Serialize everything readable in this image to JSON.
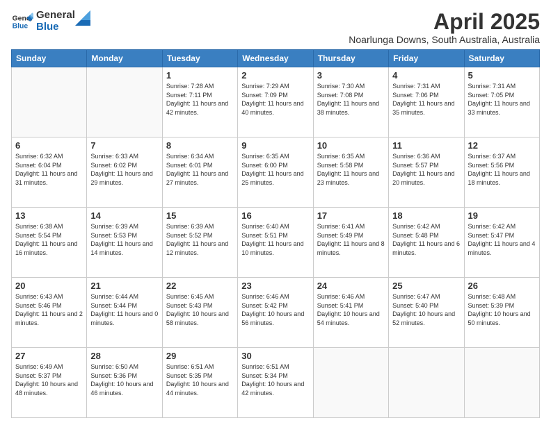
{
  "logo": {
    "text_general": "General",
    "text_blue": "Blue"
  },
  "header": {
    "title": "April 2025",
    "subtitle": "Noarlunga Downs, South Australia, Australia"
  },
  "days_of_week": [
    "Sunday",
    "Monday",
    "Tuesday",
    "Wednesday",
    "Thursday",
    "Friday",
    "Saturday"
  ],
  "weeks": [
    [
      {
        "day": "",
        "sunrise": "",
        "sunset": "",
        "daylight": "",
        "empty": true
      },
      {
        "day": "",
        "sunrise": "",
        "sunset": "",
        "daylight": "",
        "empty": true
      },
      {
        "day": "1",
        "sunrise": "Sunrise: 7:28 AM",
        "sunset": "Sunset: 7:11 PM",
        "daylight": "Daylight: 11 hours and 42 minutes.",
        "empty": false
      },
      {
        "day": "2",
        "sunrise": "Sunrise: 7:29 AM",
        "sunset": "Sunset: 7:09 PM",
        "daylight": "Daylight: 11 hours and 40 minutes.",
        "empty": false
      },
      {
        "day": "3",
        "sunrise": "Sunrise: 7:30 AM",
        "sunset": "Sunset: 7:08 PM",
        "daylight": "Daylight: 11 hours and 38 minutes.",
        "empty": false
      },
      {
        "day": "4",
        "sunrise": "Sunrise: 7:31 AM",
        "sunset": "Sunset: 7:06 PM",
        "daylight": "Daylight: 11 hours and 35 minutes.",
        "empty": false
      },
      {
        "day": "5",
        "sunrise": "Sunrise: 7:31 AM",
        "sunset": "Sunset: 7:05 PM",
        "daylight": "Daylight: 11 hours and 33 minutes.",
        "empty": false
      }
    ],
    [
      {
        "day": "6",
        "sunrise": "Sunrise: 6:32 AM",
        "sunset": "Sunset: 6:04 PM",
        "daylight": "Daylight: 11 hours and 31 minutes.",
        "empty": false
      },
      {
        "day": "7",
        "sunrise": "Sunrise: 6:33 AM",
        "sunset": "Sunset: 6:02 PM",
        "daylight": "Daylight: 11 hours and 29 minutes.",
        "empty": false
      },
      {
        "day": "8",
        "sunrise": "Sunrise: 6:34 AM",
        "sunset": "Sunset: 6:01 PM",
        "daylight": "Daylight: 11 hours and 27 minutes.",
        "empty": false
      },
      {
        "day": "9",
        "sunrise": "Sunrise: 6:35 AM",
        "sunset": "Sunset: 6:00 PM",
        "daylight": "Daylight: 11 hours and 25 minutes.",
        "empty": false
      },
      {
        "day": "10",
        "sunrise": "Sunrise: 6:35 AM",
        "sunset": "Sunset: 5:58 PM",
        "daylight": "Daylight: 11 hours and 23 minutes.",
        "empty": false
      },
      {
        "day": "11",
        "sunrise": "Sunrise: 6:36 AM",
        "sunset": "Sunset: 5:57 PM",
        "daylight": "Daylight: 11 hours and 20 minutes.",
        "empty": false
      },
      {
        "day": "12",
        "sunrise": "Sunrise: 6:37 AM",
        "sunset": "Sunset: 5:56 PM",
        "daylight": "Daylight: 11 hours and 18 minutes.",
        "empty": false
      }
    ],
    [
      {
        "day": "13",
        "sunrise": "Sunrise: 6:38 AM",
        "sunset": "Sunset: 5:54 PM",
        "daylight": "Daylight: 11 hours and 16 minutes.",
        "empty": false
      },
      {
        "day": "14",
        "sunrise": "Sunrise: 6:39 AM",
        "sunset": "Sunset: 5:53 PM",
        "daylight": "Daylight: 11 hours and 14 minutes.",
        "empty": false
      },
      {
        "day": "15",
        "sunrise": "Sunrise: 6:39 AM",
        "sunset": "Sunset: 5:52 PM",
        "daylight": "Daylight: 11 hours and 12 minutes.",
        "empty": false
      },
      {
        "day": "16",
        "sunrise": "Sunrise: 6:40 AM",
        "sunset": "Sunset: 5:51 PM",
        "daylight": "Daylight: 11 hours and 10 minutes.",
        "empty": false
      },
      {
        "day": "17",
        "sunrise": "Sunrise: 6:41 AM",
        "sunset": "Sunset: 5:49 PM",
        "daylight": "Daylight: 11 hours and 8 minutes.",
        "empty": false
      },
      {
        "day": "18",
        "sunrise": "Sunrise: 6:42 AM",
        "sunset": "Sunset: 5:48 PM",
        "daylight": "Daylight: 11 hours and 6 minutes.",
        "empty": false
      },
      {
        "day": "19",
        "sunrise": "Sunrise: 6:42 AM",
        "sunset": "Sunset: 5:47 PM",
        "daylight": "Daylight: 11 hours and 4 minutes.",
        "empty": false
      }
    ],
    [
      {
        "day": "20",
        "sunrise": "Sunrise: 6:43 AM",
        "sunset": "Sunset: 5:46 PM",
        "daylight": "Daylight: 11 hours and 2 minutes.",
        "empty": false
      },
      {
        "day": "21",
        "sunrise": "Sunrise: 6:44 AM",
        "sunset": "Sunset: 5:44 PM",
        "daylight": "Daylight: 11 hours and 0 minutes.",
        "empty": false
      },
      {
        "day": "22",
        "sunrise": "Sunrise: 6:45 AM",
        "sunset": "Sunset: 5:43 PM",
        "daylight": "Daylight: 10 hours and 58 minutes.",
        "empty": false
      },
      {
        "day": "23",
        "sunrise": "Sunrise: 6:46 AM",
        "sunset": "Sunset: 5:42 PM",
        "daylight": "Daylight: 10 hours and 56 minutes.",
        "empty": false
      },
      {
        "day": "24",
        "sunrise": "Sunrise: 6:46 AM",
        "sunset": "Sunset: 5:41 PM",
        "daylight": "Daylight: 10 hours and 54 minutes.",
        "empty": false
      },
      {
        "day": "25",
        "sunrise": "Sunrise: 6:47 AM",
        "sunset": "Sunset: 5:40 PM",
        "daylight": "Daylight: 10 hours and 52 minutes.",
        "empty": false
      },
      {
        "day": "26",
        "sunrise": "Sunrise: 6:48 AM",
        "sunset": "Sunset: 5:39 PM",
        "daylight": "Daylight: 10 hours and 50 minutes.",
        "empty": false
      }
    ],
    [
      {
        "day": "27",
        "sunrise": "Sunrise: 6:49 AM",
        "sunset": "Sunset: 5:37 PM",
        "daylight": "Daylight: 10 hours and 48 minutes.",
        "empty": false
      },
      {
        "day": "28",
        "sunrise": "Sunrise: 6:50 AM",
        "sunset": "Sunset: 5:36 PM",
        "daylight": "Daylight: 10 hours and 46 minutes.",
        "empty": false
      },
      {
        "day": "29",
        "sunrise": "Sunrise: 6:51 AM",
        "sunset": "Sunset: 5:35 PM",
        "daylight": "Daylight: 10 hours and 44 minutes.",
        "empty": false
      },
      {
        "day": "30",
        "sunrise": "Sunrise: 6:51 AM",
        "sunset": "Sunset: 5:34 PM",
        "daylight": "Daylight: 10 hours and 42 minutes.",
        "empty": false
      },
      {
        "day": "",
        "sunrise": "",
        "sunset": "",
        "daylight": "",
        "empty": true
      },
      {
        "day": "",
        "sunrise": "",
        "sunset": "",
        "daylight": "",
        "empty": true
      },
      {
        "day": "",
        "sunrise": "",
        "sunset": "",
        "daylight": "",
        "empty": true
      }
    ]
  ]
}
